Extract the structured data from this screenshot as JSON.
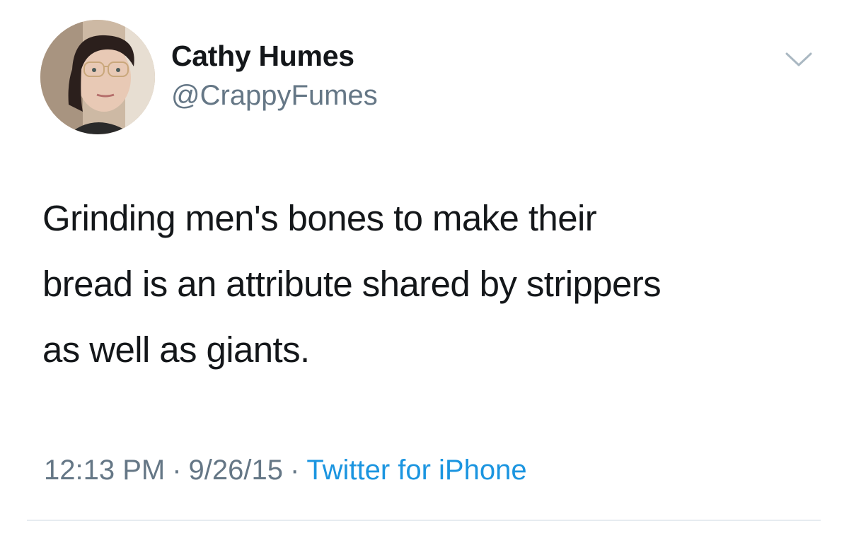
{
  "author": {
    "display_name": "Cathy Humes",
    "handle": "@CrappyFumes",
    "avatar_icon": "profile-photo"
  },
  "menu": {
    "icon": "chevron-down-icon"
  },
  "tweet": {
    "lines": [
      "Grinding men's bones to make their",
      "bread is an attribute shared by strippers",
      "as well as giants."
    ]
  },
  "meta": {
    "time": "12:13 PM",
    "separator": "·",
    "date": "9/26/15",
    "source": "Twitter for iPhone"
  },
  "colors": {
    "text": "#14171a",
    "secondary": "#657786",
    "link": "#1b95e0",
    "divider": "#e6ecf0"
  }
}
